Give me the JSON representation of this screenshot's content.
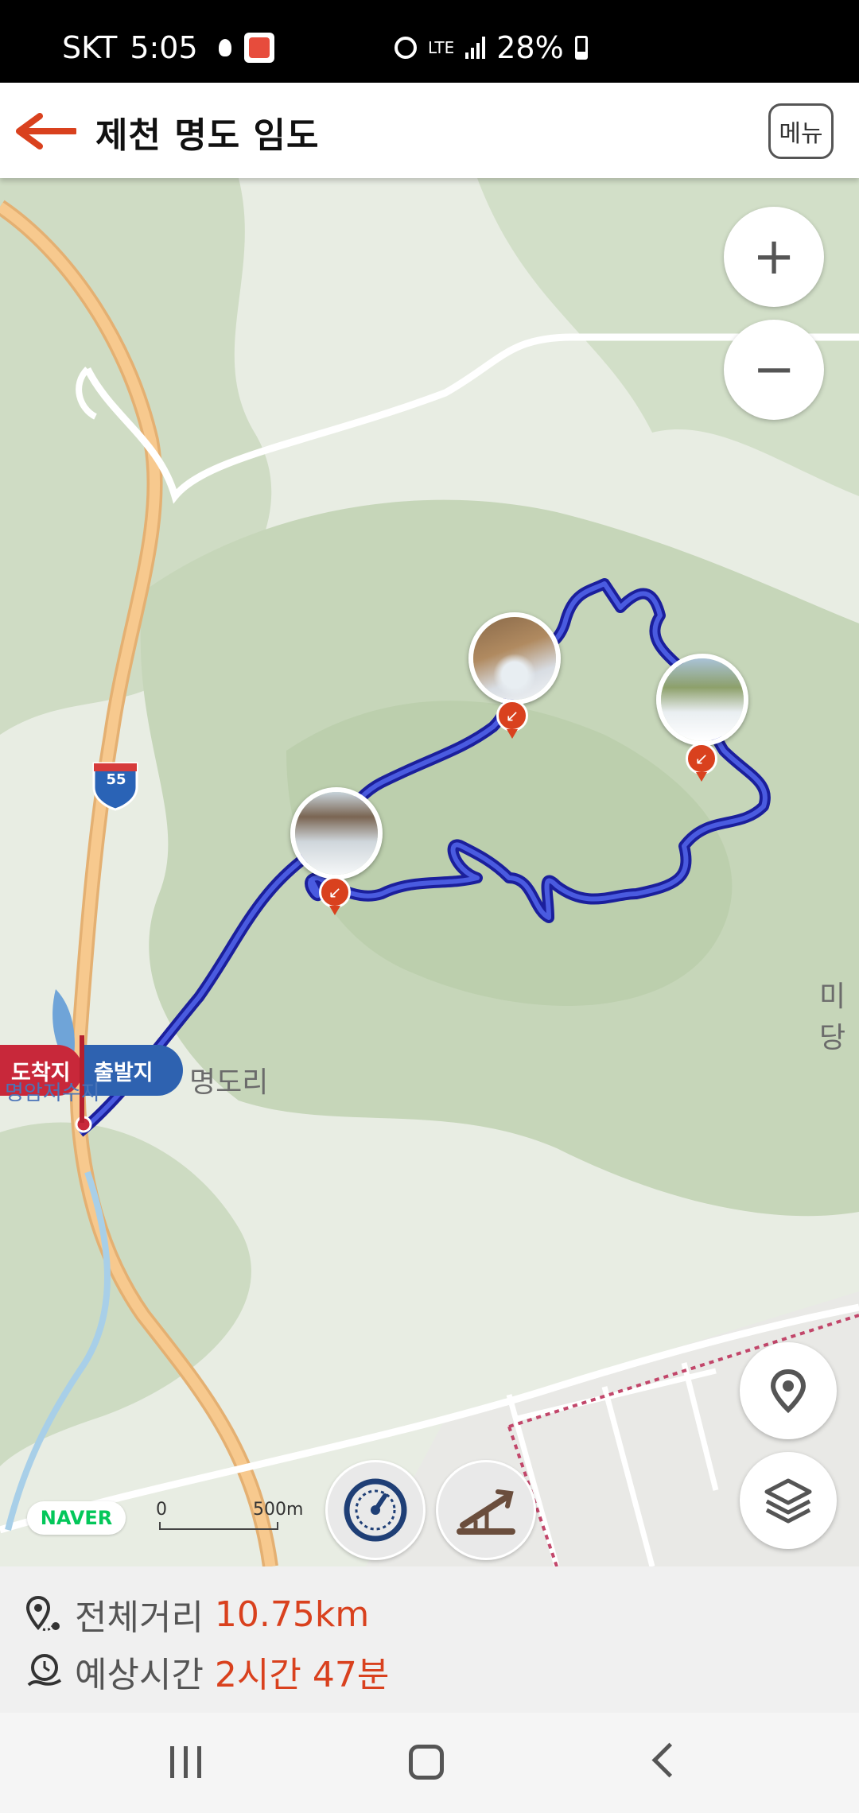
{
  "status_bar": {
    "carrier": "SKT",
    "time": "5:05",
    "network": "LTE",
    "battery": "28%"
  },
  "header": {
    "title": "제천 명도 임도",
    "menu_label": "메뉴",
    "back_icon": "back-arrow-icon"
  },
  "map": {
    "zoom_in": "+",
    "zoom_out": "−",
    "highway_number": "55",
    "flag_arrive": "도착지",
    "flag_start": "출발지",
    "place_village": "명도리",
    "place_reservoir": "명암저수지",
    "place_edge": "미당",
    "provider": "NAVER",
    "scale_start": "0",
    "scale_end": "500m",
    "route_color": "#2b2fc9",
    "pin_color": "#d9411e"
  },
  "info": {
    "distance_label": "전체거리",
    "distance_value": "10.75km",
    "time_label": "예상시간",
    "time_value": "2시간 47분"
  }
}
